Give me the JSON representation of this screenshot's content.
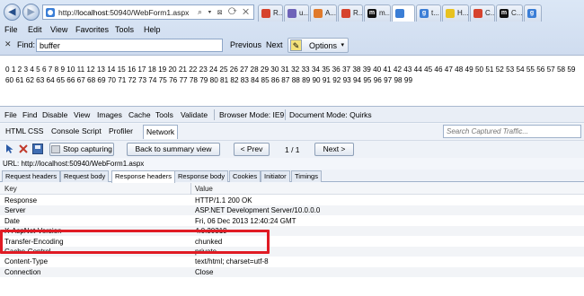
{
  "browser": {
    "address": {
      "prefix": "http://",
      "host": "localhost",
      "rest": ":50940/WebForm1.aspx",
      "icons": "⌕ ▾ ⊠ ⟳ ✕"
    },
    "tabs": [
      {
        "label": "R...",
        "icon_color": "#d6432d",
        "icon_text": ""
      },
      {
        "label": "u...",
        "icon_color": "#6e63b8",
        "icon_text": ""
      },
      {
        "label": "A...",
        "icon_color": "#e07a2b",
        "icon_text": ""
      },
      {
        "label": "R...",
        "icon_color": "#d6432d",
        "icon_text": ""
      },
      {
        "label": "m...",
        "icon_color": "#111111",
        "icon_text": "m"
      },
      {
        "label": "",
        "icon_color": "#3b7ed6",
        "icon_text": ""
      },
      {
        "label": "t...",
        "icon_color": "#3b7ed6",
        "icon_text": "g"
      },
      {
        "label": "H...",
        "icon_color": "#e8c21f",
        "icon_text": ""
      },
      {
        "label": "C...",
        "icon_color": "#d6432d",
        "icon_text": ""
      },
      {
        "label": "C...",
        "icon_color": "#111111",
        "icon_text": "m"
      },
      {
        "label": "",
        "icon_color": "#3b7ed6",
        "icon_text": "g"
      }
    ],
    "menu": [
      "File",
      "Edit",
      "View",
      "Favorites",
      "Tools",
      "Help"
    ],
    "find": {
      "close": "✕",
      "label": "Find:",
      "value": "buffer",
      "previous": "Previous",
      "next": "Next",
      "options": "Options",
      "options_caret": "▾"
    }
  },
  "page": {
    "numbers_text": "0 1 2 3 4 5 6 7 8 9 10 11 12 13 14 15 16 17 18 19 20 21 22 23 24 25 26 27 28 29 30 31 32 33 34 35 36 37 38 39 40 41 42 43 44 45 46 47 48 49 50 51 52 53 54 55 56 57 58 59 60 61 62 63 64 65 66 67 68 69 70 71 72 73 74 75 76 77 78 79 80 81 82 83 84 85 86 87 88 89 90 91 92 93 94 95 96 97 98 99"
  },
  "devtools": {
    "menu": [
      "File",
      "Find",
      "Disable",
      "View",
      "Images",
      "Cache",
      "Tools",
      "Validate"
    ],
    "browser_mode": "Browser Mode: IE9",
    "document_mode": "Document Mode: Quirks",
    "tabs": [
      "HTML",
      "CSS",
      "Console",
      "Script",
      "Profiler",
      "Network"
    ],
    "active_tab": "Network",
    "search_placeholder": "Search Captured Traffic...",
    "toolbar": {
      "stop_capturing": "Stop capturing",
      "back_to_summary": "Back to summary view",
      "prev": "< Prev",
      "pager": "1 / 1",
      "next": "Next >"
    },
    "url_line": "URL: http://localhost:50940/WebForm1.aspx",
    "subtabs": [
      "Request headers",
      "Request body",
      "Response headers",
      "Response body",
      "Cookies",
      "Initiator",
      "Timings"
    ],
    "active_subtab": "Response headers",
    "grid": {
      "col_key": "Key",
      "col_value": "Value",
      "rows": [
        {
          "key": "Response",
          "value": "HTTP/1.1 200 OK"
        },
        {
          "key": "Server",
          "value": "ASP.NET Development Server/10.0.0.0"
        },
        {
          "key": "Date",
          "value": "Fri, 06 Dec 2013 12:40:24 GMT"
        },
        {
          "key": "X-AspNet-Version",
          "value": "4.0.30319"
        },
        {
          "key": "Transfer-Encoding",
          "value": "chunked"
        },
        {
          "key": "Cache-Control",
          "value": "private"
        },
        {
          "key": "Content-Type",
          "value": "text/html; charset=utf-8"
        },
        {
          "key": "Connection",
          "value": "Close"
        }
      ]
    }
  },
  "colors": {
    "highlight": "#e01b24",
    "chrome": "#dbe7f6"
  }
}
